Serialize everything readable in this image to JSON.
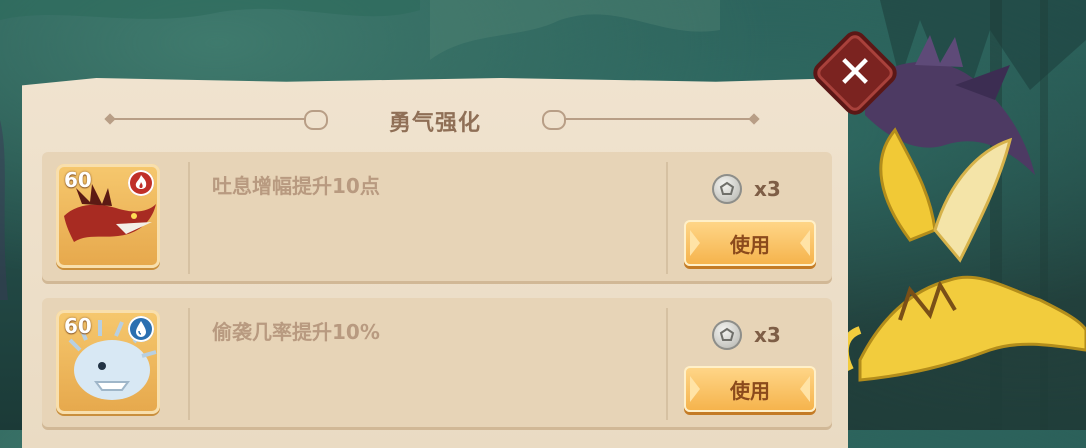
{
  "dialog": {
    "title": "勇气强化",
    "items": [
      {
        "level": "60",
        "element": "fire",
        "element_icon": "fire-element-icon",
        "description": "吐息增幅提升10点",
        "cost_icon": "silver-badge-coin-icon",
        "cost_quantity": "x3",
        "button_label": "使用"
      },
      {
        "level": "60",
        "element": "water",
        "element_icon": "water-element-icon",
        "description": "偷袭几率提升10%",
        "cost_icon": "silver-badge-coin-icon",
        "cost_quantity": "x3",
        "button_label": "使用"
      }
    ],
    "close_label": "✕"
  },
  "colors": {
    "panel": "#eadbc3",
    "row": "#e7d4b7",
    "title": "#8f6f56",
    "button": "#f5b24a",
    "close": "#7b2320",
    "fire": "#c02f28",
    "water": "#2a6fb0"
  }
}
